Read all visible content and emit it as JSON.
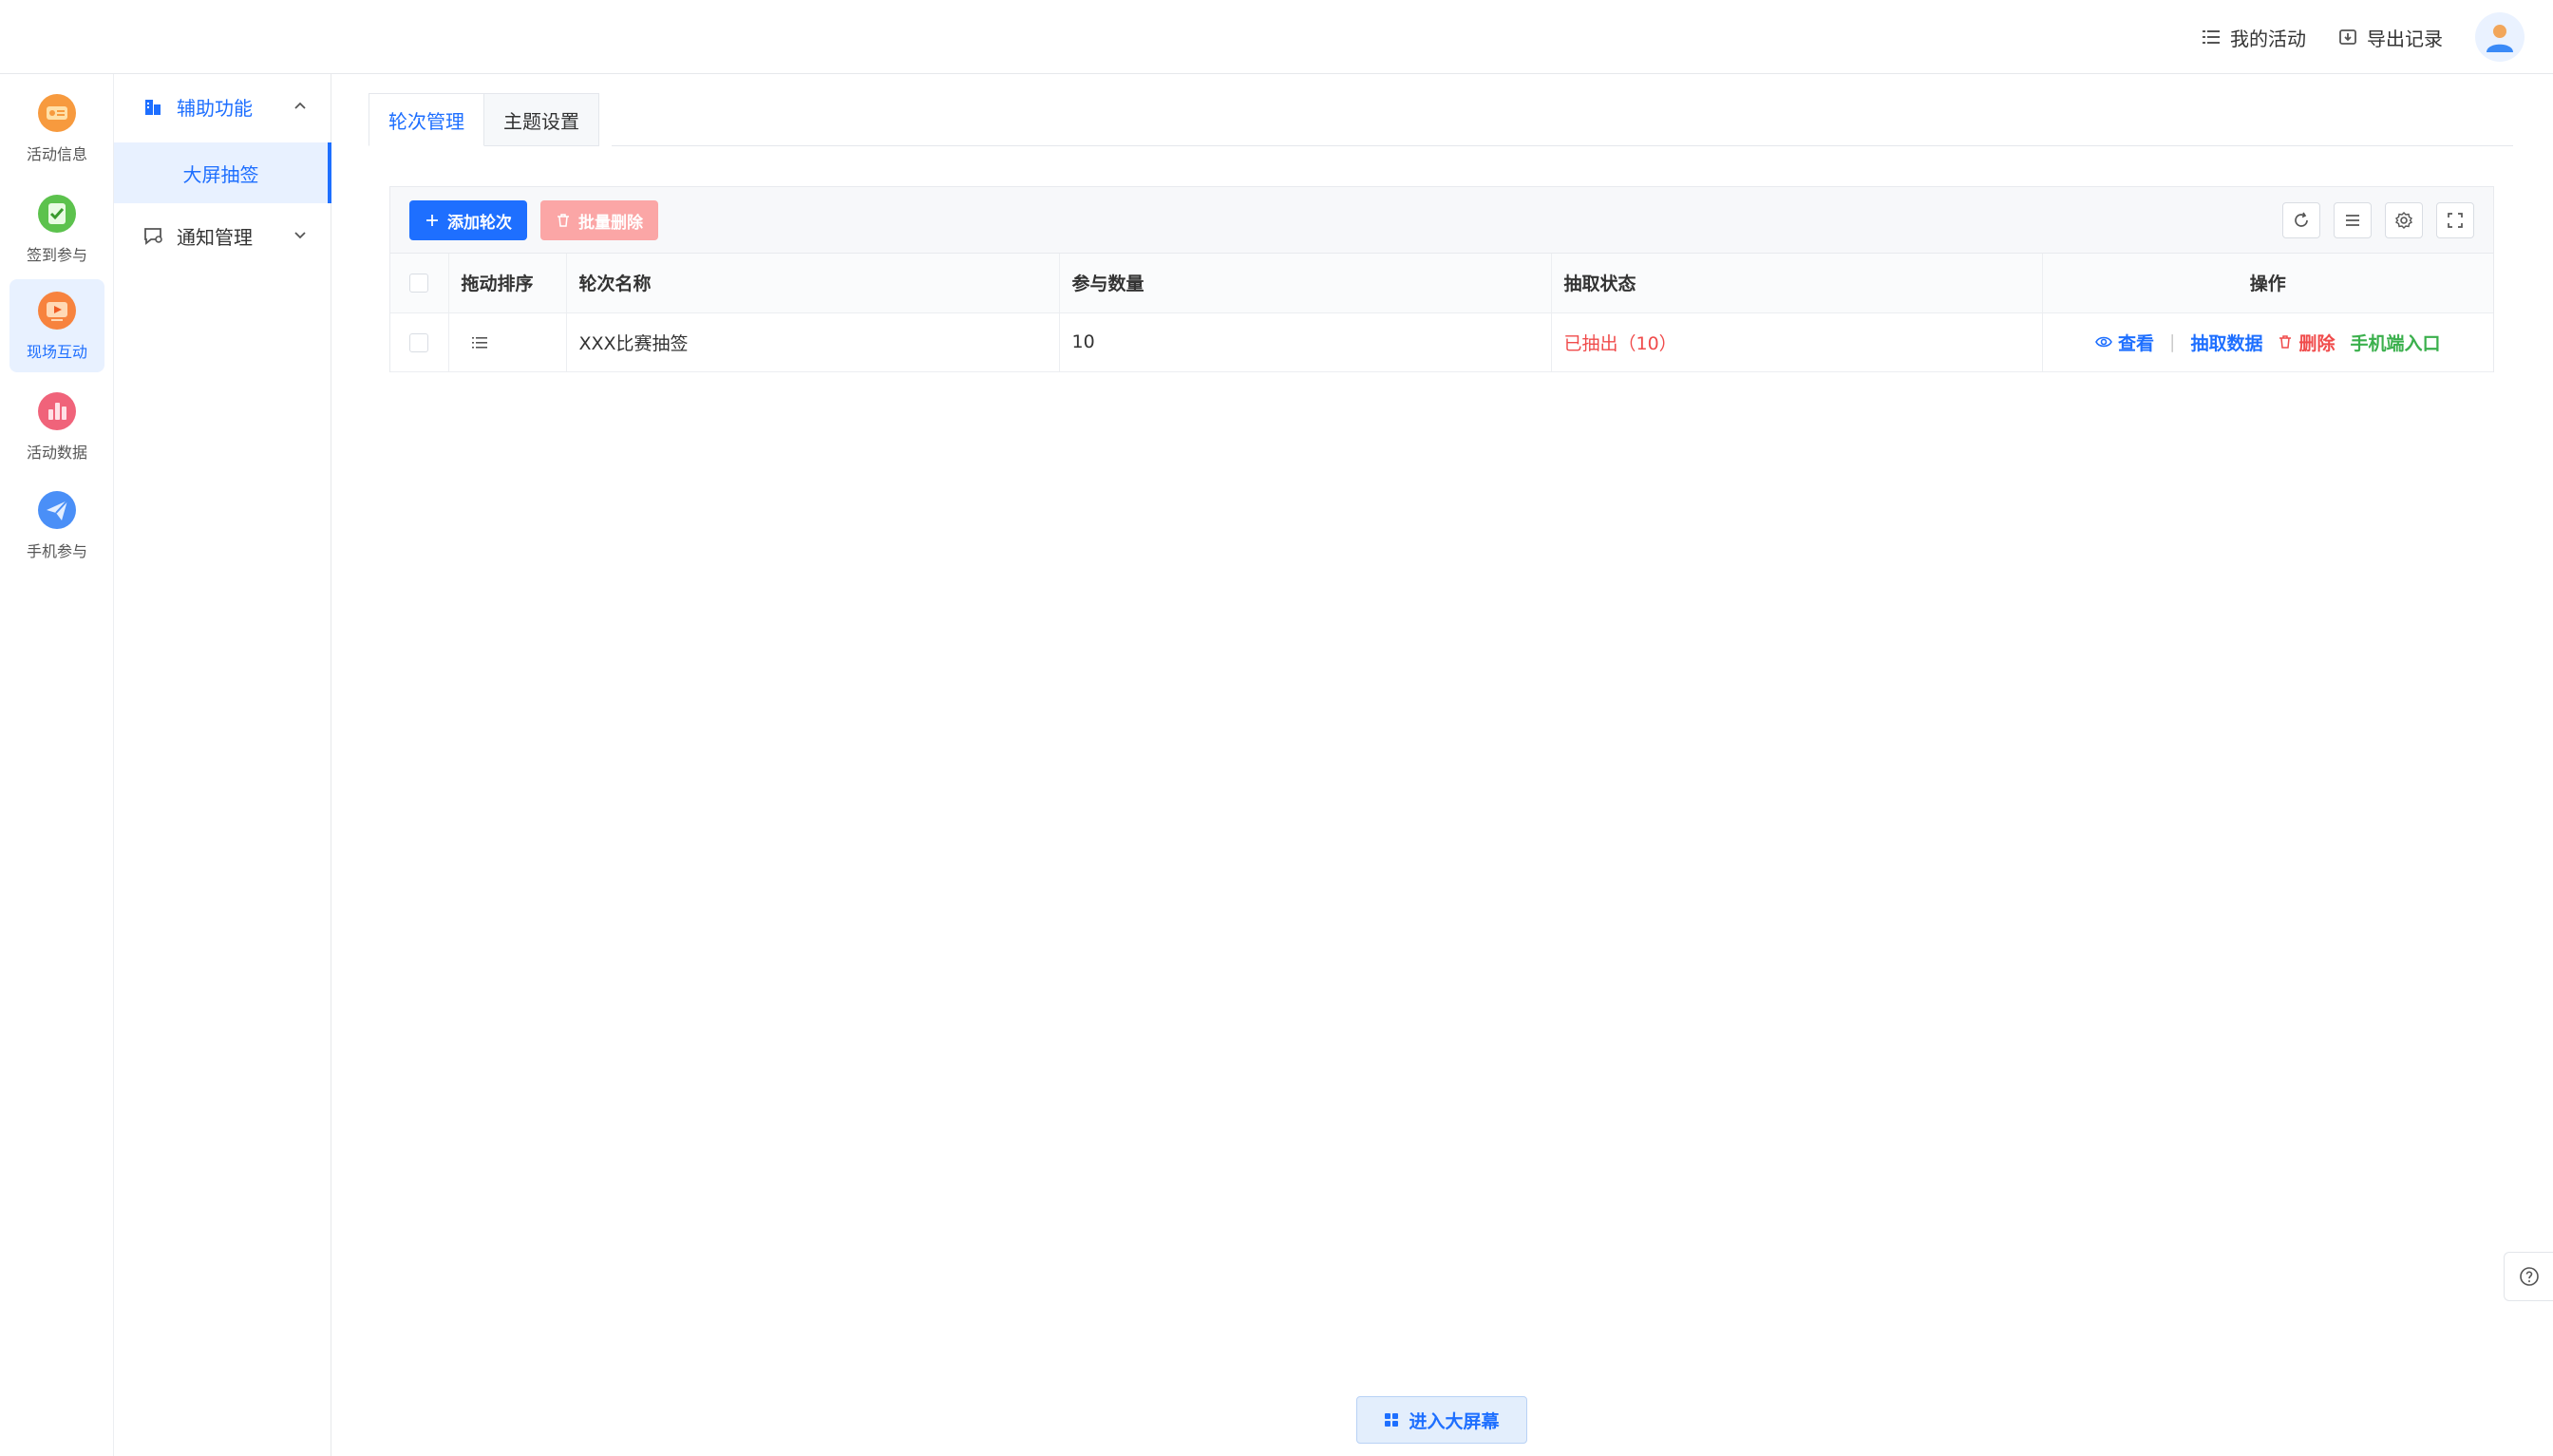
{
  "header": {
    "my_activity": "我的活动",
    "export_records": "导出记录"
  },
  "rail": [
    {
      "label": "活动信息",
      "icon": "activity-info-icon",
      "active": false
    },
    {
      "label": "签到参与",
      "icon": "checkin-icon",
      "active": false
    },
    {
      "label": "现场互动",
      "icon": "live-interaction-icon",
      "active": true
    },
    {
      "label": "活动数据",
      "icon": "activity-data-icon",
      "active": false
    },
    {
      "label": "手机参与",
      "icon": "mobile-participation-icon",
      "active": false
    }
  ],
  "submenu": {
    "group1": "辅助功能",
    "group1_item": "大屏抽签",
    "group2": "通知管理"
  },
  "tabs": [
    "轮次管理",
    "主题设置"
  ],
  "toolbar": {
    "add": "添加轮次",
    "batch_delete": "批量删除"
  },
  "table": {
    "headers": [
      "拖动排序",
      "轮次名称",
      "参与数量",
      "抽取状态",
      "操作"
    ],
    "rows": [
      {
        "name": "XXX比赛抽签",
        "count": "10",
        "status": "已抽出（10）"
      }
    ],
    "ops": {
      "view": "查看",
      "draw_data": "抽取数据",
      "delete": "删除",
      "mobile_entry": "手机端入口"
    }
  },
  "enter_big_screen": "进入大屏幕",
  "colors": {
    "primary": "#1e6fff",
    "danger": "#f04b4b",
    "success": "#3bb04d"
  }
}
